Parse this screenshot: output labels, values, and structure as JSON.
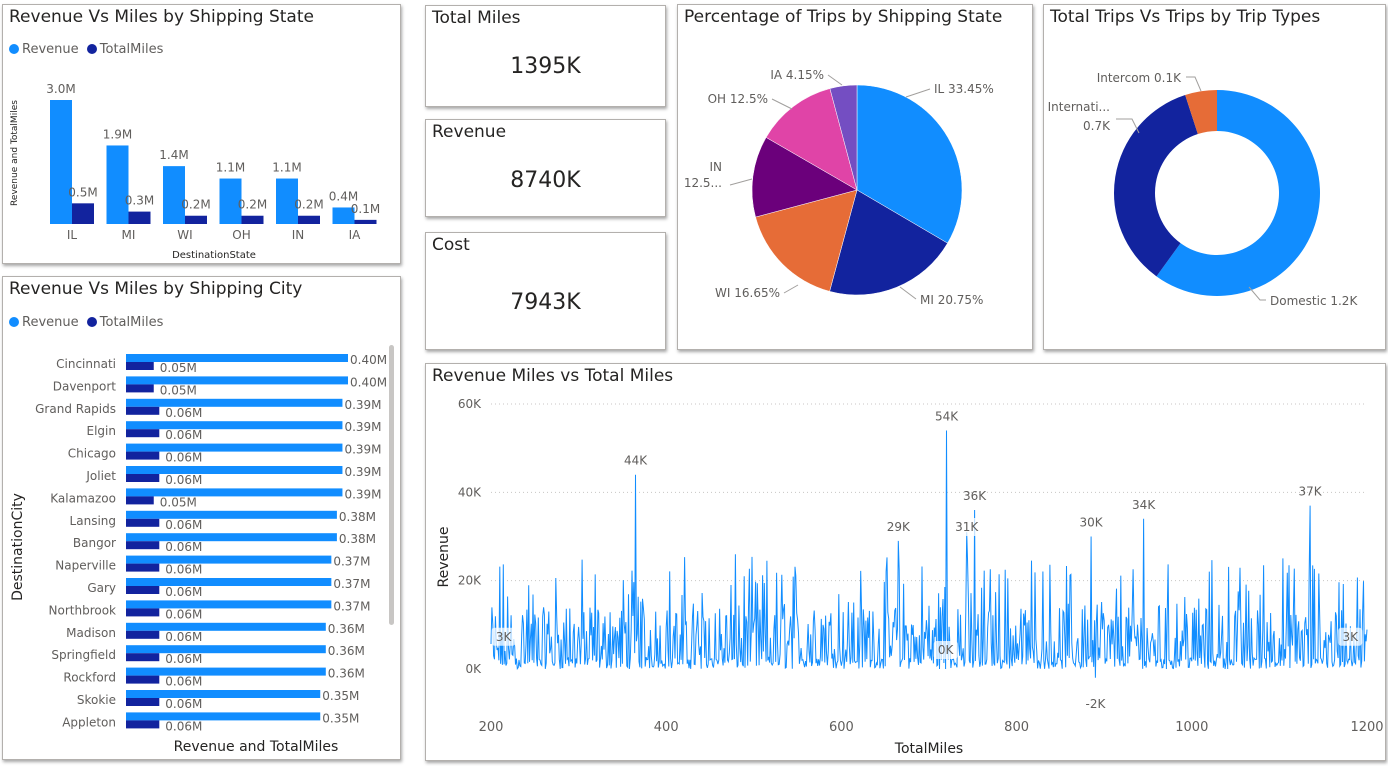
{
  "colors": {
    "revenue": "#118dff",
    "total_miles": "#12239e",
    "il": "#118dff",
    "mi": "#12239e",
    "wi": "#e66c37",
    "in": "#6b007b",
    "oh": "#e044a7",
    "ia": "#744ec2"
  },
  "state_chart": {
    "title": "Revenue Vs Miles by Shipping State",
    "legend": [
      "Revenue",
      "TotalMiles"
    ],
    "xlabel": "DestinationState",
    "ylabel": "Revenue and TotalMiles",
    "chart_data": {
      "type": "bar",
      "categories": [
        "IL",
        "MI",
        "WI",
        "OH",
        "IN",
        "IA"
      ],
      "series": [
        {
          "name": "Revenue",
          "values": [
            3.0,
            1.9,
            1.4,
            1.1,
            1.1,
            0.4
          ],
          "labels": [
            "3.0M",
            "1.9M",
            "1.4M",
            "1.1M",
            "1.1M",
            "0.4M"
          ]
        },
        {
          "name": "TotalMiles",
          "values": [
            0.5,
            0.3,
            0.2,
            0.2,
            0.2,
            0.1
          ],
          "labels": [
            "0.5M",
            "0.3M",
            "0.2M",
            "0.2M",
            "0.2M",
            "0.1M"
          ]
        }
      ],
      "unit": "M"
    }
  },
  "city_chart": {
    "title": "Revenue Vs Miles by Shipping City",
    "legend": [
      "Revenue",
      "TotalMiles"
    ],
    "xlabel": "Revenue and TotalMiles",
    "ylabel": "DestinationCity",
    "chart_data": {
      "type": "bar",
      "orientation": "horizontal",
      "categories": [
        "Cincinnati",
        "Davenport",
        "Grand Rapids",
        "Elgin",
        "Chicago",
        "Joliet",
        "Kalamazoo",
        "Lansing",
        "Bangor",
        "Naperville",
        "Gary",
        "Northbrook",
        "Madison",
        "Springfield",
        "Rockford",
        "Skokie",
        "Appleton"
      ],
      "series": [
        {
          "name": "Revenue",
          "values": [
            0.4,
            0.4,
            0.39,
            0.39,
            0.39,
            0.39,
            0.39,
            0.38,
            0.38,
            0.37,
            0.37,
            0.37,
            0.36,
            0.36,
            0.36,
            0.35,
            0.35
          ],
          "labels": [
            "0.40M",
            "0.40M",
            "0.39M",
            "0.39M",
            "0.39M",
            "0.39M",
            "0.39M",
            "0.38M",
            "0.38M",
            "0.37M",
            "0.37M",
            "0.37M",
            "0.36M",
            "0.36M",
            "0.36M",
            "0.35M",
            "0.35M"
          ]
        },
        {
          "name": "TotalMiles",
          "values": [
            0.05,
            0.05,
            0.06,
            0.06,
            0.06,
            0.06,
            0.05,
            0.06,
            0.06,
            0.06,
            0.06,
            0.06,
            0.06,
            0.06,
            0.06,
            0.06,
            0.06
          ],
          "labels": [
            "0.05M",
            "0.05M",
            "0.06M",
            "0.06M",
            "0.06M",
            "0.06M",
            "0.05M",
            "0.06M",
            "0.06M",
            "0.06M",
            "0.06M",
            "0.06M",
            "0.06M",
            "0.06M",
            "0.06M",
            "0.06M",
            "0.06M"
          ]
        }
      ],
      "unit": "M"
    }
  },
  "kpis": [
    {
      "label": "Total Miles",
      "value": "1395K"
    },
    {
      "label": "Revenue",
      "value": "8740K"
    },
    {
      "label": "Cost",
      "value": "7943K"
    }
  ],
  "pie_chart": {
    "title": "Percentage of Trips by Shipping State",
    "chart_data": {
      "type": "pie",
      "slices": [
        {
          "name": "IL",
          "value": 33.45,
          "label": "IL 33.45%"
        },
        {
          "name": "MI",
          "value": 20.75,
          "label": "MI 20.75%"
        },
        {
          "name": "WI",
          "value": 16.65,
          "label": "WI 16.65%"
        },
        {
          "name": "IN",
          "value": 12.5,
          "label_line1": "IN",
          "label_line2": "12.5..."
        },
        {
          "name": "OH",
          "value": 12.5,
          "label": "OH 12.5%"
        },
        {
          "name": "IA",
          "value": 4.15,
          "label": "IA 4.15%"
        }
      ]
    }
  },
  "donut_chart": {
    "title": "Total Trips Vs Trips by Trip Types",
    "chart_data": {
      "type": "pie",
      "donut": true,
      "slices": [
        {
          "name": "Domestic",
          "value": 1.2,
          "label": "Domestic 1.2K",
          "color": "#118dff"
        },
        {
          "name": "International",
          "value": 0.7,
          "label_line1": "Internati...",
          "label_line2": "0.7K",
          "color": "#12239e"
        },
        {
          "name": "Intercom",
          "value": 0.1,
          "label": "Intercom 0.1K",
          "color": "#e66c37"
        }
      ]
    }
  },
  "line_chart": {
    "title": "Revenue Miles vs Total Miles",
    "xlabel": "TotalMiles",
    "ylabel": "Revenue",
    "chart_data": {
      "type": "line",
      "xlim": [
        200,
        1200
      ],
      "ylim": [
        0,
        60000
      ],
      "xticks": [
        "200",
        "400",
        "600",
        "800",
        "1000",
        "1200"
      ],
      "yticks": [
        "0K",
        "20K",
        "40K",
        "60K"
      ],
      "grid": "horizontal-dotted",
      "annotations": [
        {
          "x": 203,
          "y": 3000,
          "label": "3K"
        },
        {
          "x": 365,
          "y": 44000,
          "label": "44K"
        },
        {
          "x": 665,
          "y": 29000,
          "label": "29K"
        },
        {
          "x": 719,
          "y": 0,
          "label": "0K"
        },
        {
          "x": 720,
          "y": 54000,
          "label": "54K"
        },
        {
          "x": 743,
          "y": 31000,
          "label": "31K"
        },
        {
          "x": 752,
          "y": 36000,
          "label": "36K"
        },
        {
          "x": 885,
          "y": 30000,
          "label": "30K"
        },
        {
          "x": 890,
          "y": -2000,
          "label": "-2K"
        },
        {
          "x": 945,
          "y": 34000,
          "label": "34K"
        },
        {
          "x": 1135,
          "y": 37000,
          "label": "37K"
        },
        {
          "x": 1190,
          "y": 3000,
          "label": "3K"
        }
      ]
    }
  }
}
